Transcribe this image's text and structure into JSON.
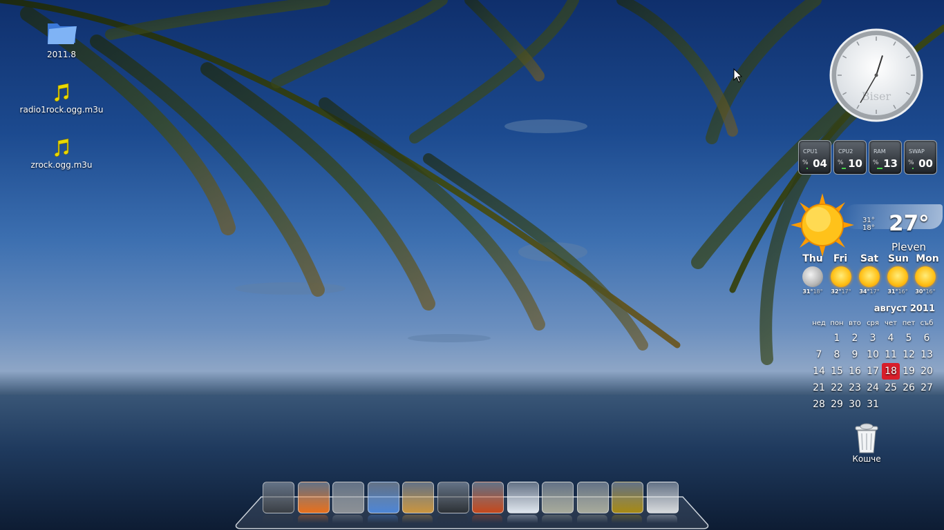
{
  "desktop": {
    "icons": [
      {
        "label": "2011.8",
        "icon": "folder-icon"
      },
      {
        "label": "radio1rock.ogg.m3u",
        "icon": "music-note-icon"
      },
      {
        "label": "zrock.ogg.m3u",
        "icon": "music-note-icon"
      }
    ]
  },
  "clock": {
    "brand": "Biser",
    "hour": 12,
    "minute": 35
  },
  "system_meters": [
    {
      "label": "CPU1",
      "prefix": "%",
      "value": "04",
      "fraction": 0.04
    },
    {
      "label": "CPU2",
      "prefix": "%",
      "value": "10",
      "fraction": 0.1
    },
    {
      "label": "RAM",
      "prefix": "%",
      "value": "13",
      "fraction": 0.13
    },
    {
      "label": "SWAP",
      "prefix": "%",
      "value": "00",
      "fraction": 0.0
    }
  ],
  "weather": {
    "current_temp": "27°",
    "high": "31°",
    "low": "18°",
    "city": "Pleven",
    "forecast": [
      {
        "day": "Thu",
        "high": "31°",
        "low": "18°",
        "icon": "moon-icon"
      },
      {
        "day": "Fri",
        "high": "32°",
        "low": "17°",
        "icon": "sun-icon"
      },
      {
        "day": "Sat",
        "high": "34°",
        "low": "17°",
        "icon": "sun-icon"
      },
      {
        "day": "Sun",
        "high": "31°",
        "low": "16°",
        "icon": "sun-icon"
      },
      {
        "day": "Mon",
        "high": "30°",
        "low": "16°",
        "icon": "sun-icon"
      }
    ]
  },
  "calendar": {
    "title": "август 2011",
    "weekdays": [
      "нед",
      "пон",
      "вто",
      "сря",
      "чет",
      "пет",
      "съб"
    ],
    "weeks": [
      [
        "",
        "1",
        "2",
        "3",
        "4",
        "5",
        "6"
      ],
      [
        "7",
        "8",
        "9",
        "10",
        "11",
        "12",
        "13"
      ],
      [
        "14",
        "15",
        "16",
        "17",
        "18",
        "19",
        "20"
      ],
      [
        "21",
        "22",
        "23",
        "24",
        "25",
        "26",
        "27"
      ],
      [
        "28",
        "29",
        "30",
        "31",
        "",
        "",
        ""
      ]
    ],
    "today": "18",
    "today_color": "#d81e2a"
  },
  "trash": {
    "label": "Кошче"
  },
  "dock": {
    "items": [
      {
        "name": "terminal-icon",
        "color": "#3a3f45"
      },
      {
        "name": "firefox-icon",
        "color": "#e8701c"
      },
      {
        "name": "calculator-icon",
        "color": "#8c9196"
      },
      {
        "name": "pidgin-icon",
        "color": "#4d86d6"
      },
      {
        "name": "paint-palette-icon",
        "color": "#c9953f"
      },
      {
        "name": "window-list-icon",
        "color": "#2c3136"
      },
      {
        "name": "ubuntu-software-icon",
        "color": "#c5481c"
      },
      {
        "name": "system-monitor-icon",
        "color": "#dfe6ee"
      },
      {
        "name": "documents-folder-icon",
        "color": "#a8ab9c"
      },
      {
        "name": "downloads-folder-icon",
        "color": "#a8ab9c"
      },
      {
        "name": "image-viewer-icon",
        "color": "#a78a14"
      },
      {
        "name": "power-icon",
        "color": "#d7dadd"
      }
    ]
  }
}
